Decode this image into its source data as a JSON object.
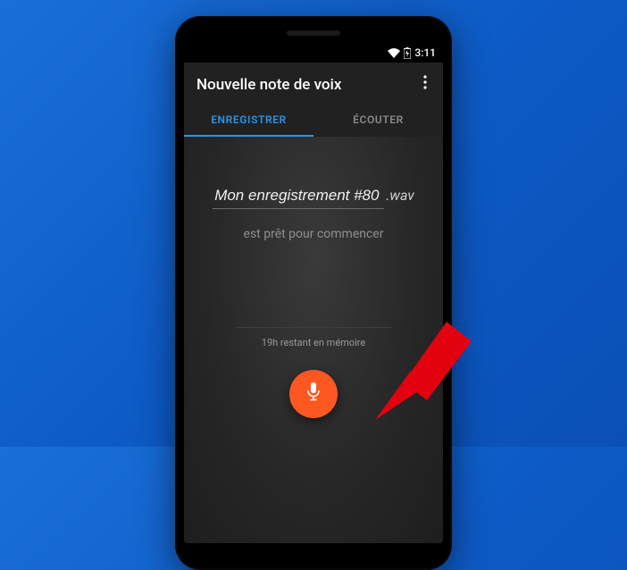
{
  "statusbar": {
    "time": "3:11"
  },
  "appbar": {
    "title": "Nouvelle note de voix"
  },
  "tabs": {
    "record": "ENREGISTRER",
    "listen": "ÉCOUTER"
  },
  "recording": {
    "filename": "Mon enregistrement #80",
    "extension": ".wav",
    "ready_text": "est prêt pour commencer",
    "memory_text": "19h restant en mémoire"
  },
  "colors": {
    "accent": "#2196f3",
    "record": "#ff5722"
  }
}
